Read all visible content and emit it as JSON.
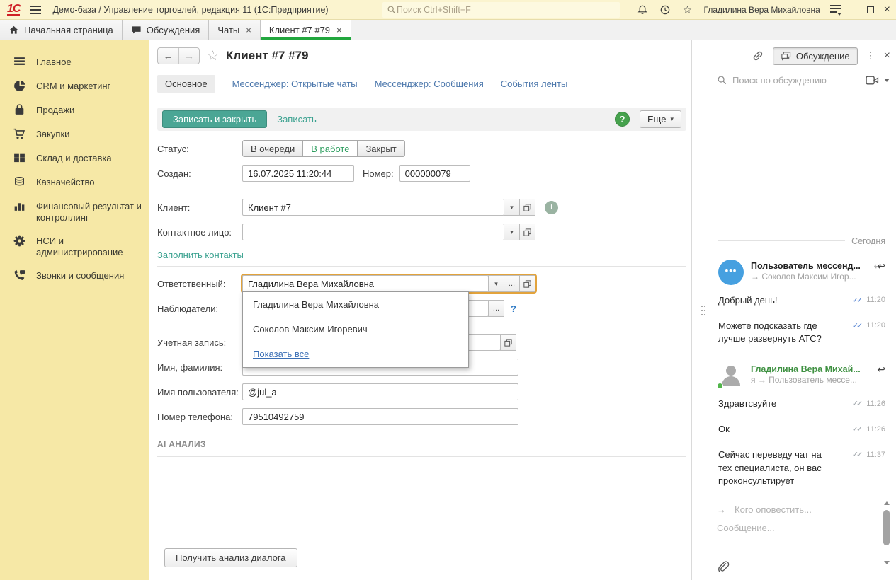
{
  "icons": {
    "logo": "1С",
    "star": "☆",
    "back": "←",
    "fwd": "→",
    "minimize": "–",
    "close": "×",
    "dots_v": "⋮",
    "caret": "▾",
    "more_dots": "...",
    "arrow_right": "→",
    "reply": "↩",
    "double_check": "✓✓",
    "plus": "+",
    "avatar_dots": "•••"
  },
  "topbar": {
    "app_title": "Демо-база / Управление торговлей, редакция 11  (1С:Предприятие)",
    "search_placeholder": "Поиск Ctrl+Shift+F",
    "user_name": "Гладилина Вера Михайловна"
  },
  "tabs": {
    "home": "Начальная страница",
    "discussions": "Обсуждения",
    "chats": "Чаты",
    "client": "Клиент #7 #79"
  },
  "sidebar": {
    "items": [
      {
        "label": "Главное"
      },
      {
        "label": "CRM и маркетинг"
      },
      {
        "label": "Продажи"
      },
      {
        "label": "Закупки"
      },
      {
        "label": "Склад и доставка"
      },
      {
        "label": "Казначейство"
      },
      {
        "label": "Финансовый результат и контроллинг"
      },
      {
        "label": "НСИ и администрирование"
      },
      {
        "label": "Звонки и сообщения"
      }
    ]
  },
  "form": {
    "title": "Клиент #7 #79",
    "nav": {
      "main": "Основное",
      "open_chats": "Мессенджер: Открытые чаты",
      "messages": "Мессенджер: Сообщения",
      "feed": "События ленты"
    },
    "toolbar": {
      "save_close": "Записать и закрыть",
      "save": "Записать",
      "help": "?",
      "more": "Еще"
    },
    "status": {
      "label": "Статус:",
      "queued": "В очереди",
      "in_progress": "В работе",
      "closed": "Закрыт"
    },
    "created": {
      "label": "Создан:",
      "value": "16.07.2025 11:20:44"
    },
    "number": {
      "label": "Номер:",
      "value": "000000079"
    },
    "client": {
      "label": "Клиент:",
      "value": "Клиент #7"
    },
    "contact": {
      "label": "Контактное лицо:",
      "value": ""
    },
    "fill_contacts": "Заполнить контакты",
    "responsible": {
      "label": "Ответственный:",
      "value": "Гладилина Вера Михайловна"
    },
    "watchers": {
      "label": "Наблюдатели:",
      "value": "",
      "hint": "?"
    },
    "account": {
      "label": "Учетная запись:",
      "value": ""
    },
    "fullname": {
      "label": "Имя, фамилия:",
      "value": ""
    },
    "username": {
      "label": "Имя пользователя:",
      "value": "@jul_a"
    },
    "phone": {
      "label": "Номер телефона:",
      "value": "79510492759"
    },
    "ai_section": "AI АНАЛИЗ",
    "analyze_button": "Получить анализ диалога",
    "dropdown": {
      "items": [
        "Гладилина Вера Михайловна",
        "Соколов Максим Игоревич"
      ],
      "show_all": "Показать все"
    }
  },
  "chat": {
    "panel_button": "Обсуждение",
    "search_placeholder": "Поиск по обсуждению",
    "day": "Сегодня",
    "groups": [
      {
        "author": "Пользователь мессенд...",
        "route": "→ Соколов Максим Игор...",
        "messages": [
          {
            "text": "Добрый день!",
            "time": "11:20"
          },
          {
            "text": "Можете подсказать где лучше развернуть АТС?",
            "time": "11:20"
          }
        ]
      },
      {
        "author": "Гладилина Вера Михай...",
        "route": "я → Пользователь мессе...",
        "messages": [
          {
            "text": "Здравтсвуйте",
            "time": "11:26"
          },
          {
            "text": "Ок",
            "time": "11:26"
          },
          {
            "text": "Сейчас переведу чат на тех специалиста, он вас проконсультирует",
            "time": "11:37"
          }
        ]
      }
    ],
    "notify_placeholder": "Кого оповестить...",
    "message_placeholder": "Сообщение..."
  },
  "colors": {
    "accent_teal": "#4ba695",
    "focus_orange": "#e2a33c",
    "tab_green": "#22a73e",
    "link_blue": "#4a76ab",
    "sidebar_yellow": "#f6e8a6",
    "topbar_yellow": "#fbf4cf"
  }
}
